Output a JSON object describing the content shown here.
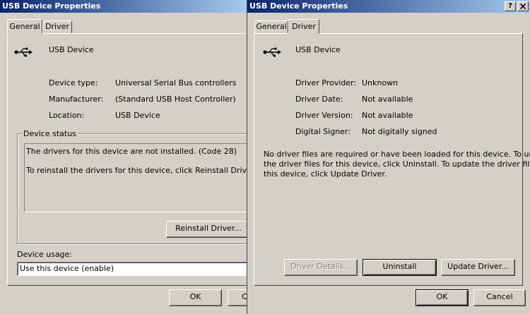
{
  "left_dialog": {
    "title": "USB Device Properties",
    "tabs": [
      {
        "label": "General",
        "active": true
      },
      {
        "label": "Driver",
        "active": false
      }
    ],
    "device_icon": "usb-trident-icon",
    "device_name": "USB Device",
    "properties": [
      {
        "label": "Device type:",
        "value": "Universal Serial Bus controllers"
      },
      {
        "label": "Manufacturer:",
        "value": "(Standard USB Host Controller)"
      },
      {
        "label": "Location:",
        "value": "USB Device"
      }
    ],
    "device_status": {
      "legend": "Device status",
      "line1": "The drivers for this device are not installed. (Code 28)",
      "line2": "To reinstall the drivers for this device, click Reinstall Driver."
    },
    "reinstall_button": "Reinstall Driver...",
    "device_usage": {
      "label": "Device usage:",
      "value": "Use this device (enable)"
    },
    "ok_button": "OK",
    "cancel_button_partial": "C"
  },
  "right_dialog": {
    "title": "USB Device Properties",
    "help_button": "?",
    "close_icon": "close-x-icon",
    "tabs": [
      {
        "label": "General",
        "active": false
      },
      {
        "label": "Driver",
        "active": true
      }
    ],
    "device_icon": "usb-trident-icon",
    "device_name": "USB Device",
    "driver_info": [
      {
        "label": "Driver Provider:",
        "value": "Unknown"
      },
      {
        "label": "Driver Date:",
        "value": "Not available"
      },
      {
        "label": "Driver Version:",
        "value": "Not available"
      },
      {
        "label": "Digital Signer:",
        "value": "Not digitally signed"
      }
    ],
    "message_lines": [
      "No driver files are required or have been loaded for this device. To uninstall",
      "the driver files for this device, click Uninstall. To update the driver files for",
      "this device, click Update Driver."
    ],
    "driver_details_button": "Driver Details...",
    "uninstall_button": "Uninstall",
    "update_driver_button": "Update Driver...",
    "ok_button": "OK",
    "cancel_button": "Cancel"
  }
}
